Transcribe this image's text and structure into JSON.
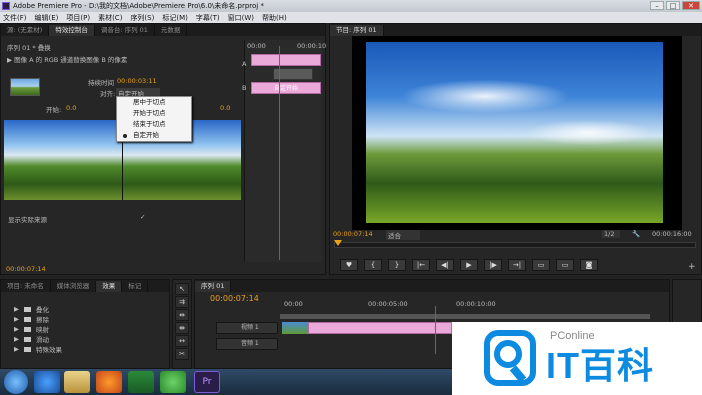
{
  "window": {
    "title": "Adobe Premiere Pro - D:\\我的文档\\Adobe\\Premiere Pro\\6.0\\未命名.prproj *"
  },
  "menu": [
    "文件(F)",
    "编辑(E)",
    "项目(P)",
    "素材(C)",
    "序列(S)",
    "标记(M)",
    "字幕(T)",
    "窗口(W)",
    "帮助(H)"
  ],
  "source_panel": {
    "tabs": [
      "源: (无素材)",
      "特效控制台",
      "调音台: 序列 01",
      "元数据"
    ],
    "header": "序列 01 * 叠换",
    "effect_desc": "图像 A 的 RGB 通道替换图像 B 的像素",
    "duration_label": "持续时间",
    "duration_value": "00:00:03:11",
    "align_label": "对齐:",
    "align_value": "自定开始",
    "start_label": "开始:",
    "start_value": "0.0",
    "end_value": "0.0",
    "show_actual": "显示实际来源",
    "timecode": "00:00:07:14",
    "ruler_left": "00:00",
    "ruler_right": "00:00:10",
    "track_a": "A",
    "track_b": "B",
    "clip_b": "自定开始"
  },
  "context_menu": {
    "items": [
      "居中于切点",
      "开始于切点",
      "结束于切点",
      "自定开始"
    ],
    "selected": 3
  },
  "program_panel": {
    "tab": "节目: 序列 01",
    "timecode": "00:00:07:14",
    "fit": "适合",
    "res": "1/2",
    "duration": "00:00:16:00"
  },
  "project_panel": {
    "tabs": [
      "项目: 未命名",
      "媒体浏览器",
      "效果",
      "标记"
    ],
    "bins": [
      "叠化",
      "擦除",
      "映射",
      "滑动",
      "特殊效果"
    ]
  },
  "timeline": {
    "tab": "序列 01",
    "timecode": "00:00:07:14",
    "ruler": [
      "00:00",
      "00:00:05:00",
      "00:00:10:00"
    ],
    "track_video": "视频 1",
    "track_audio": "音频 1"
  },
  "watermark": {
    "brand": "PConline",
    "name": "IT百科"
  },
  "colors": {
    "accent": "#e8a21a",
    "clip": "#e9a9d9",
    "playhead": "#d23b2b",
    "brand": "#0c8be0"
  }
}
